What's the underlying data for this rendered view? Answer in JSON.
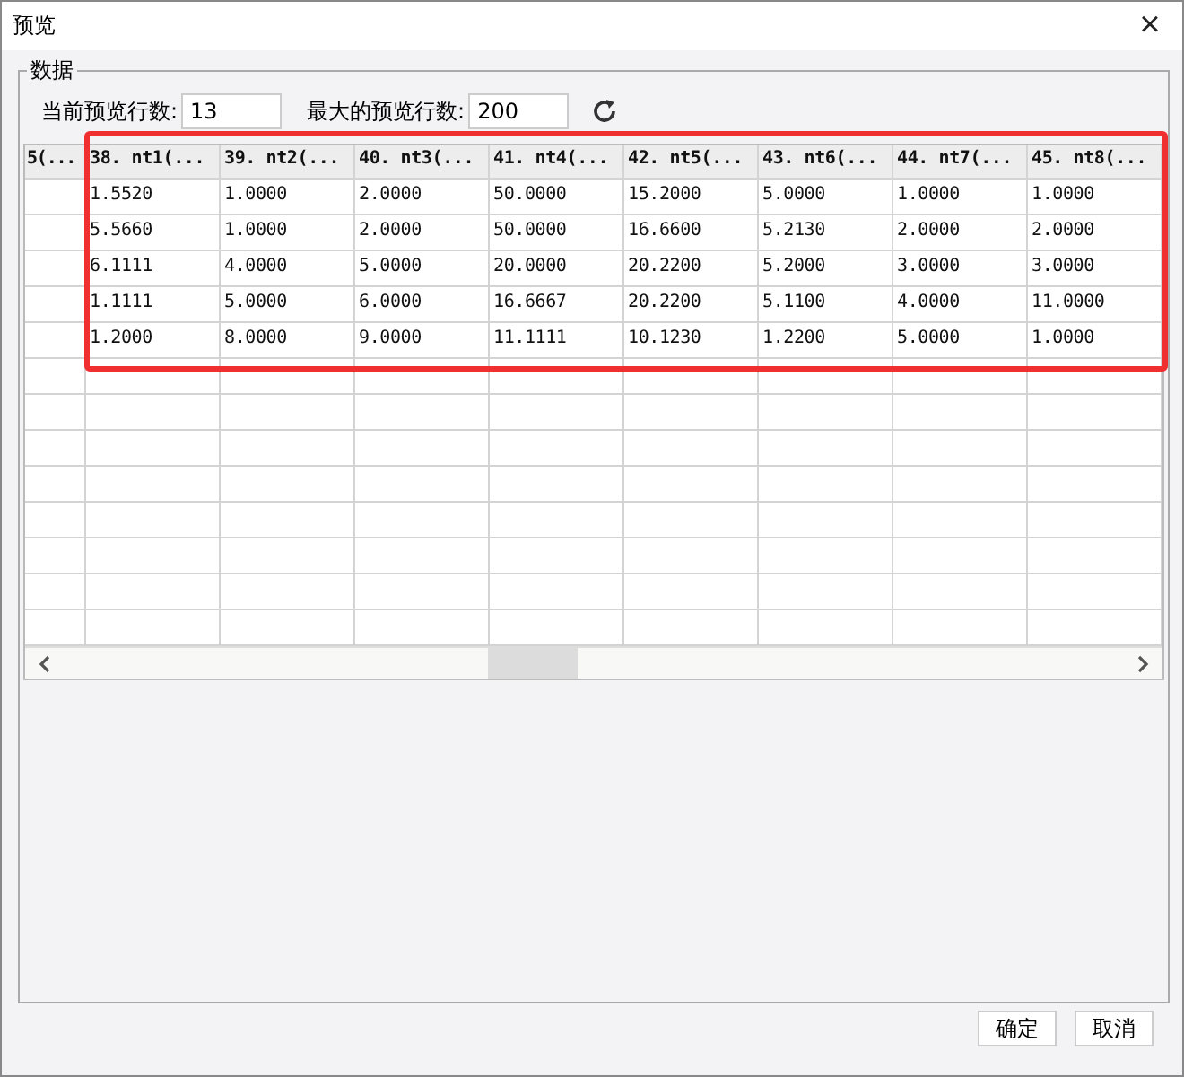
{
  "window": {
    "title": "预览",
    "close": "×"
  },
  "group": {
    "title": "数据"
  },
  "controls": {
    "current_rows_label": "当前预览行数:",
    "current_rows": "13",
    "max_rows_label": "最大的预览行数:",
    "max_rows": "200"
  },
  "table": {
    "columns": [
      "5(...",
      "38. nt1(...",
      "39. nt2(...",
      "40. nt3(...",
      "41. nt4(...",
      "42. nt5(...",
      "43. nt6(...",
      "44. nt7(...",
      "45. nt8(..."
    ],
    "rows": [
      {
        "cells": [
          "",
          "1.5520",
          "1.0000",
          "2.0000",
          "50.0000",
          "15.2000",
          "5.0000",
          "1.0000",
          "1.0000"
        ]
      },
      {
        "cells": [
          "",
          "5.5660",
          "1.0000",
          "2.0000",
          "50.0000",
          "16.6600",
          "5.2130",
          "2.0000",
          "2.0000"
        ]
      },
      {
        "cells": [
          "",
          "6.1111",
          "4.0000",
          "5.0000",
          "20.0000",
          "20.2200",
          "5.2000",
          "3.0000",
          "3.0000"
        ]
      },
      {
        "cells": [
          "",
          "1.1111",
          "5.0000",
          "6.0000",
          "16.6667",
          "20.2200",
          "5.1100",
          "4.0000",
          "11.0000"
        ]
      },
      {
        "cells": [
          "",
          "1.2000",
          "8.0000",
          "9.0000",
          "11.1111",
          "10.1230",
          "1.2200",
          "5.0000",
          "1.0000"
        ]
      }
    ]
  },
  "buttons": [
    "确定",
    "取消"
  ]
}
